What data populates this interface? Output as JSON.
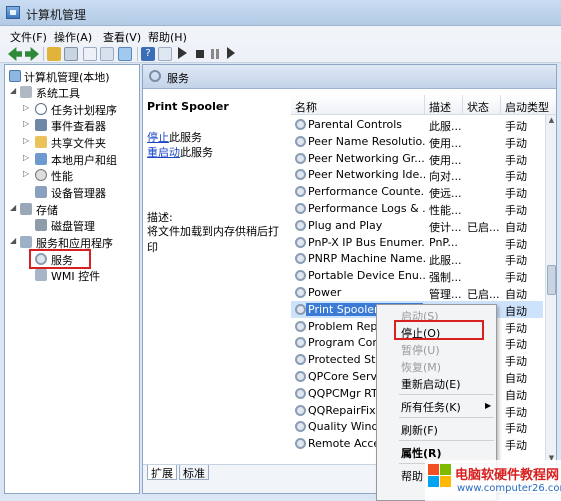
{
  "window": {
    "title": "计算机管理"
  },
  "menu": [
    "文件(F)",
    "操作(A)",
    "查看(V)",
    "帮助(H)"
  ],
  "tree": {
    "items": [
      {
        "label": "计算机管理(本地)",
        "icon": "computer-icon",
        "exp": ""
      },
      {
        "label": "系统工具",
        "icon": "tools-icon",
        "exp": "◢"
      },
      {
        "label": "任务计划程序",
        "icon": "clock-icon",
        "exp": "▷"
      },
      {
        "label": "事件查看器",
        "icon": "event-viewer-icon",
        "exp": "▷"
      },
      {
        "label": "共享文件夹",
        "icon": "shared-folder-icon",
        "exp": "▷"
      },
      {
        "label": "本地用户和组",
        "icon": "users-icon",
        "exp": "▷"
      },
      {
        "label": "性能",
        "icon": "performance-icon",
        "exp": "▷"
      },
      {
        "label": "设备管理器",
        "icon": "device-manager-icon",
        "exp": ""
      },
      {
        "label": "存储",
        "icon": "storage-icon",
        "exp": "◢"
      },
      {
        "label": "磁盘管理",
        "icon": "disk-icon",
        "exp": ""
      },
      {
        "label": "服务和应用程序",
        "icon": "services-apps-icon",
        "exp": "◢"
      },
      {
        "label": "服务",
        "icon": "services-icon",
        "exp": ""
      },
      {
        "label": "WMI 控件",
        "icon": "wmi-icon",
        "exp": ""
      }
    ]
  },
  "services_header": {
    "title": "服务"
  },
  "detail": {
    "name": "Print Spooler",
    "stop_link": "停止",
    "stop_suffix": "此服务",
    "restart_link": "重启动",
    "restart_suffix": "此服务",
    "desc_label": "描述:",
    "description": "将文件加载到内存供稍后打印"
  },
  "columns": [
    "名称",
    "描述",
    "状态",
    "启动类型"
  ],
  "rows": [
    {
      "name": "Parental Controls",
      "desc": "此服...",
      "status": "",
      "startup": "手动"
    },
    {
      "name": "Peer Name Resolutio...",
      "desc": "使用...",
      "status": "",
      "startup": "手动"
    },
    {
      "name": "Peer Networking Gr...",
      "desc": "使用...",
      "status": "",
      "startup": "手动"
    },
    {
      "name": "Peer Networking Ide...",
      "desc": "向对...",
      "status": "",
      "startup": "手动"
    },
    {
      "name": "Performance Counte...",
      "desc": "使远...",
      "status": "",
      "startup": "手动"
    },
    {
      "name": "Performance Logs & ...",
      "desc": "性能...",
      "status": "",
      "startup": "手动"
    },
    {
      "name": "Plug and Play",
      "desc": "使计...",
      "status": "已启...",
      "startup": "自动"
    },
    {
      "name": "PnP-X IP Bus Enumer...",
      "desc": "PnP...",
      "status": "",
      "startup": "手动"
    },
    {
      "name": "PNRP Machine Name...",
      "desc": "此服...",
      "status": "",
      "startup": "手动"
    },
    {
      "name": "Portable Device Enu...",
      "desc": "强制...",
      "status": "",
      "startup": "手动"
    },
    {
      "name": "Power",
      "desc": "管理...",
      "status": "已启...",
      "startup": "自动"
    },
    {
      "name": "Print Spooler",
      "desc": "",
      "status": "",
      "startup": "自动"
    },
    {
      "name": "Problem Repo",
      "desc": "",
      "status": "",
      "startup": "手动"
    },
    {
      "name": "Program Com",
      "desc": "",
      "status": "",
      "startup": "手动"
    },
    {
      "name": "Protected Sto",
      "desc": "",
      "status": "",
      "startup": "手动"
    },
    {
      "name": "QPCore Servi",
      "desc": "",
      "status": "",
      "startup": "自动"
    },
    {
      "name": "QQPCMgr RT",
      "desc": "",
      "status": "",
      "startup": "自动"
    },
    {
      "name": "QQRepairFixS",
      "desc": "",
      "status": "",
      "startup": "手动"
    },
    {
      "name": "Quality Windo",
      "desc": "",
      "status": "",
      "startup": "手动"
    },
    {
      "name": "Remote Acce",
      "desc": "",
      "status": "",
      "startup": "手动"
    }
  ],
  "tabs": [
    "扩展",
    "标准"
  ],
  "context_menu": {
    "start": "启动(S)",
    "stop": "停止(O)",
    "pause": "暂停(U)",
    "resume": "恢复(M)",
    "restart": "重新启动(E)",
    "all_tasks": "所有任务(K)",
    "refresh": "刷新(F)",
    "properties": "属性(R)",
    "help": "帮助"
  },
  "watermark": {
    "title": "电脑软硬件教程网",
    "url": "www.computer26.com"
  },
  "colors": {
    "selection": "#3b7bd6",
    "highlight_box": "#d92020",
    "window_frame": "#c9dcf2"
  }
}
